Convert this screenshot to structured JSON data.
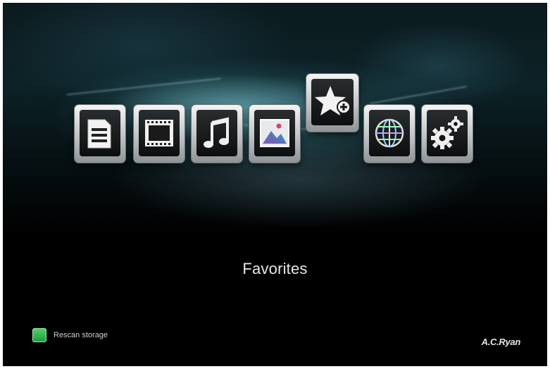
{
  "menu": {
    "items": [
      {
        "icon": "document-icon"
      },
      {
        "icon": "film-icon"
      },
      {
        "icon": "music-note-icon"
      },
      {
        "icon": "photo-icon"
      },
      {
        "icon": "star-plus-icon",
        "selected": true
      },
      {
        "icon": "globe-icon"
      },
      {
        "icon": "gears-icon"
      }
    ],
    "selected_caption": "Favorites"
  },
  "footer": {
    "green_key_action": "Rescan storage",
    "brand": "A.C.Ryan"
  },
  "colors": {
    "background": "#000000",
    "glow": "#8cd7e1",
    "green_key": "#2fb84c",
    "caption_text": "#e8e8e8"
  }
}
